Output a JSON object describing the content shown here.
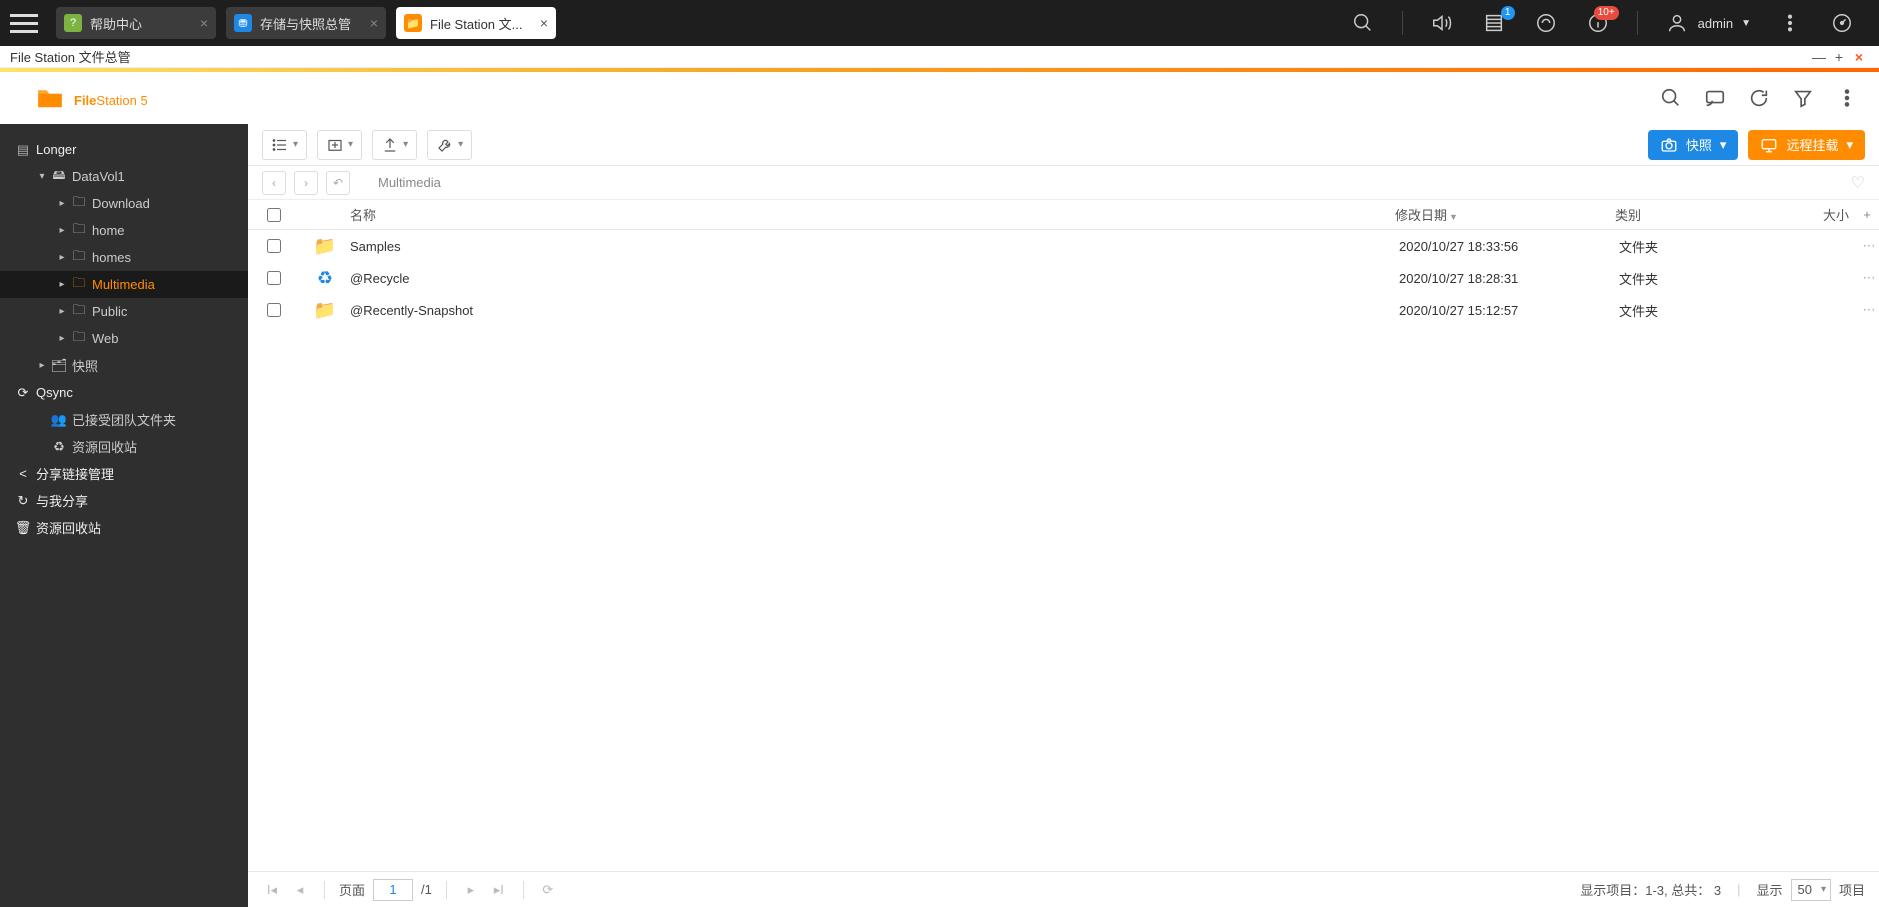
{
  "taskbar": {
    "tabs": [
      {
        "label": "帮助中心",
        "icon_bg": "#7cb342",
        "icon_text": "?",
        "active": false
      },
      {
        "label": "存储与快照总管",
        "icon_bg": "#1e88e5",
        "icon_text": "⛃",
        "active": false
      },
      {
        "label": "File Station 文...",
        "icon_bg": "#ff8c00",
        "icon_text": "📁",
        "active": true
      }
    ],
    "notif_count": "1",
    "info_count": "10+",
    "user_name": "admin"
  },
  "window": {
    "title": "File Station 文件总管"
  },
  "app": {
    "title_bold": "File",
    "title_thin": "Station 5"
  },
  "sidebar": {
    "longer": "Longer",
    "datavol": "DataVol1",
    "folders": [
      "Download",
      "home",
      "homes",
      "Multimedia",
      "Public",
      "Web"
    ],
    "selected": "Multimedia",
    "snapshot": "快照",
    "qsync": "Qsync",
    "qsync_items": [
      "已接受团队文件夹",
      "资源回收站"
    ],
    "share_link": "分享链接管理",
    "share_me": "与我分享",
    "recycle": "资源回收站"
  },
  "actions": {
    "snapshot_btn": "快照",
    "remote_btn": "远程挂载"
  },
  "breadcrumb": {
    "path": "Multimedia"
  },
  "columns": {
    "name": "名称",
    "date": "修改日期",
    "type": "类别",
    "size": "大小"
  },
  "rows": [
    {
      "icon": "folder",
      "name": "Samples",
      "date": "2020/10/27 18:33:56",
      "type": "文件夹",
      "size": ""
    },
    {
      "icon": "recycle",
      "name": "@Recycle",
      "date": "2020/10/27 18:28:31",
      "type": "文件夹",
      "size": ""
    },
    {
      "icon": "folder",
      "name": "@Recently-Snapshot",
      "date": "2020/10/27 15:12:57",
      "type": "文件夹",
      "size": ""
    }
  ],
  "footer": {
    "page_label": "页面",
    "page": "1",
    "total_pages": "/1",
    "status": "显示项目：1-3, 总共： 3",
    "show_label": "显示",
    "per_page": "50",
    "items_label": "项目"
  }
}
